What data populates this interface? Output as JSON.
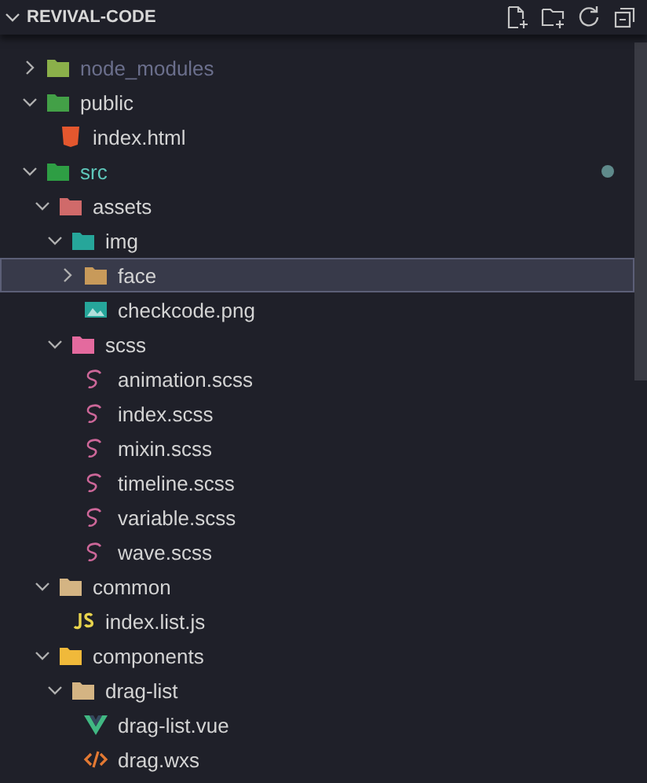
{
  "explorer": {
    "title": "REVIVAL-CODE",
    "expanded": true
  },
  "tree": [
    {
      "name": "node_modules",
      "kind": "folder",
      "color": "#8bb04a",
      "expanded": false,
      "selected": false,
      "dimmed": true,
      "modified": false
    },
    {
      "name": "public",
      "kind": "folder",
      "color": "#43a047",
      "expanded": true,
      "selected": false,
      "dimmed": false,
      "modified": false,
      "children": [
        {
          "name": "index.html",
          "kind": "html",
          "selected": false,
          "dimmed": false,
          "modified": false
        }
      ]
    },
    {
      "name": "src",
      "kind": "folder",
      "color": "#2e9e44",
      "expanded": true,
      "selected": false,
      "dimmed": false,
      "modified": true,
      "children": [
        {
          "name": "assets",
          "kind": "folder",
          "color": "#d06a6a",
          "expanded": true,
          "selected": false,
          "dimmed": false,
          "modified": false,
          "children": [
            {
              "name": "img",
              "kind": "folder",
              "color": "#26a69a",
              "expanded": true,
              "selected": false,
              "dimmed": false,
              "modified": false,
              "children": [
                {
                  "name": "face",
                  "kind": "folder",
                  "color": "#c89a5a",
                  "expanded": false,
                  "selected": true,
                  "dimmed": false,
                  "modified": false
                },
                {
                  "name": "checkcode.png",
                  "kind": "image",
                  "selected": false,
                  "dimmed": false,
                  "modified": false
                }
              ]
            },
            {
              "name": "scss",
              "kind": "folder",
              "color": "#e46a9e",
              "expanded": true,
              "selected": false,
              "dimmed": false,
              "modified": false,
              "children": [
                {
                  "name": "animation.scss",
                  "kind": "scss",
                  "selected": false,
                  "dimmed": false,
                  "modified": false
                },
                {
                  "name": "index.scss",
                  "kind": "scss",
                  "selected": false,
                  "dimmed": false,
                  "modified": false
                },
                {
                  "name": "mixin.scss",
                  "kind": "scss",
                  "selected": false,
                  "dimmed": false,
                  "modified": false
                },
                {
                  "name": "timeline.scss",
                  "kind": "scss",
                  "selected": false,
                  "dimmed": false,
                  "modified": false
                },
                {
                  "name": "variable.scss",
                  "kind": "scss",
                  "selected": false,
                  "dimmed": false,
                  "modified": false
                },
                {
                  "name": "wave.scss",
                  "kind": "scss",
                  "selected": false,
                  "dimmed": false,
                  "modified": false
                }
              ]
            }
          ]
        },
        {
          "name": "common",
          "kind": "folder",
          "color": "#d4b483",
          "expanded": true,
          "selected": false,
          "dimmed": false,
          "modified": false,
          "children": [
            {
              "name": "index.list.js",
              "kind": "js",
              "selected": false,
              "dimmed": false,
              "modified": false
            }
          ]
        },
        {
          "name": "components",
          "kind": "folder",
          "color": "#f0b93a",
          "expanded": true,
          "selected": false,
          "dimmed": false,
          "modified": false,
          "children": [
            {
              "name": "drag-list",
              "kind": "folder",
              "color": "#d4b483",
              "expanded": true,
              "selected": false,
              "dimmed": false,
              "modified": false,
              "children": [
                {
                  "name": "drag-list.vue",
                  "kind": "vue",
                  "selected": false,
                  "dimmed": false,
                  "modified": false
                },
                {
                  "name": "drag.wxs",
                  "kind": "wxs",
                  "selected": false,
                  "dimmed": false,
                  "modified": false
                }
              ]
            }
          ]
        }
      ]
    }
  ]
}
